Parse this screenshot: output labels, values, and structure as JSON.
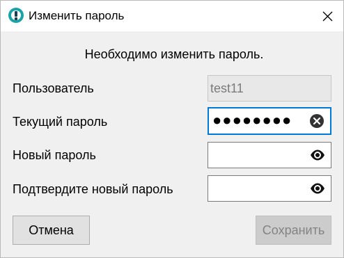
{
  "window": {
    "title": "Изменить пароль",
    "app_icon": "info-exclamation-icon",
    "close_icon": "close-icon"
  },
  "dialog": {
    "message": "Необходимо изменить пароль.",
    "fields": {
      "username": {
        "label": "Пользователь",
        "value": "test11",
        "disabled": true
      },
      "current_password": {
        "label": "Текущий пароль",
        "masked_value": "●●●●●●●●",
        "icon": "clear-icon"
      },
      "new_password": {
        "label": "Новый пароль",
        "value": "",
        "icon": "eye-icon"
      },
      "confirm_password": {
        "label": "Подтвердите новый пароль",
        "value": "",
        "icon": "eye-icon"
      }
    },
    "buttons": {
      "cancel": "Отмена",
      "save": "Сохранить"
    }
  },
  "colors": {
    "accent": "#0078d7",
    "app_icon": "#1aa3a6",
    "background": "#f0f0f0"
  }
}
